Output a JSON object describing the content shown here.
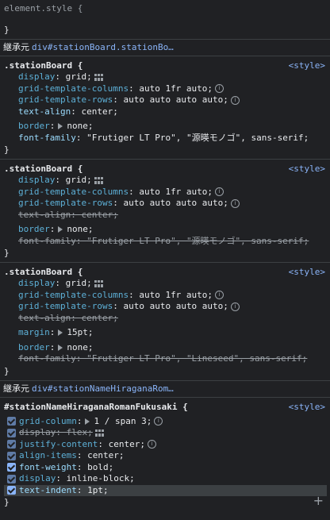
{
  "element_style": {
    "selector": "element.style {",
    "close": "}"
  },
  "inherit1": {
    "label": "継承元",
    "link": "div#stationBoard.stationBo…"
  },
  "rule1": {
    "selector": ".stationBoard {",
    "source": "<style>",
    "display_name": "display",
    "display_val": "grid;",
    "gtc_name": "grid-template-columns",
    "gtc_val": "auto 1fr auto;",
    "gtr_name": "grid-template-rows",
    "gtr_val": "auto auto auto auto;",
    "ta_name": "text-align",
    "ta_val": "center;",
    "border_name": "border",
    "border_val": "none;",
    "ff_name": "font-family",
    "ff_val1": "\"Frutiger LT Pro\"",
    "ff_val2": "\"源暎モノゴ\"",
    "ff_val3": "sans-serif;",
    "close": "}"
  },
  "rule2": {
    "selector": ".stationBoard {",
    "source": "<style>",
    "display_name": "display",
    "display_val": "grid;",
    "gtc_name": "grid-template-columns",
    "gtc_val": "auto 1fr auto;",
    "gtr_name": "grid-template-rows",
    "gtr_val": "auto auto auto auto;",
    "ta_name": "text-align",
    "ta_val": "center;",
    "border_name": "border",
    "border_val": "none;",
    "ff_name": "font-family",
    "ff_val": "\"Frutiger LT Pro\", \"源暎モノゴ\", sans-serif;",
    "close": "}"
  },
  "rule3": {
    "selector": ".stationBoard {",
    "source": "<style>",
    "display_name": "display",
    "display_val": "grid;",
    "gtc_name": "grid-template-columns",
    "gtc_val": "auto 1fr auto;",
    "gtr_name": "grid-template-rows",
    "gtr_val": "auto auto auto auto;",
    "ta_name": "text-align",
    "ta_val": "center;",
    "margin_name": "margin",
    "margin_val": "15pt;",
    "border_name": "border",
    "border_val": "none;",
    "ff_name": "font-family",
    "ff_val": "\"Frutiger LT Pro\", \"Lineseed\", sans-serif;",
    "close": "}"
  },
  "inherit2": {
    "label": "継承元",
    "link": "div#stationNameHiraganaRom…"
  },
  "rule4": {
    "selector": "#stationNameHiraganaRomanFukusaki {",
    "source": "<style>",
    "gc_name": "grid-column",
    "gc_val": "1 / span 3;",
    "disp_name": "display",
    "disp_val": "flex;",
    "jc_name": "justify-content",
    "jc_val": "center;",
    "ai_name": "align-items",
    "ai_val": "center;",
    "fw_name": "font-weight",
    "fw_val": "bold;",
    "d2_name": "display",
    "d2_val": "inline-block;",
    "ti_name": "text-indent",
    "ti_val": "1pt;",
    "close": "}",
    "add": "+"
  },
  "colors": {
    "background": "#202124",
    "link": "#8ab4f8",
    "property": "#5db0d7",
    "string": "#f28b82"
  }
}
